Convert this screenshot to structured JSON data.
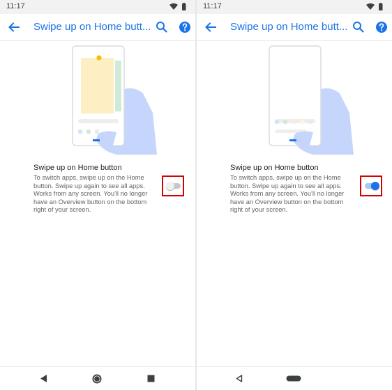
{
  "colors": {
    "accent": "#1a73e8",
    "highlight_border": "#d50000",
    "status_bar": "#f2f2f2",
    "hand": "#c5d5fb",
    "card_yellow": "#fdefc3",
    "card_green": "#cfead6",
    "dot_orange": "#fbbc04"
  },
  "icons": {
    "back": "arrow-back-icon",
    "search": "search-icon",
    "help": "help-icon",
    "wifi": "wifi-icon",
    "battery": "battery-icon",
    "nav_back": "nav-back-icon",
    "nav_home": "nav-home-icon",
    "nav_recents": "nav-recents-icon",
    "gesture_pill": "home-pill-icon"
  },
  "left_screen": {
    "status": {
      "time": "11:17"
    },
    "toolbar": {
      "title": "Swipe up on Home butt..."
    },
    "setting": {
      "title": "Swipe up on Home button",
      "description": "To switch apps, swipe up on the Home button. Swipe up again to see all apps. Works from any screen. You'll no longer have an Overview button on the bottom right of your screen.",
      "enabled": false
    },
    "navbar": {
      "style": "three-button"
    }
  },
  "right_screen": {
    "status": {
      "time": "11:17"
    },
    "toolbar": {
      "title": "Swipe up on Home butt..."
    },
    "setting": {
      "title": "Swipe up on Home button",
      "description": "To switch apps, swipe up on the Home button. Swipe up again to see all apps. Works from any screen. You'll no longer have an Overview button on the bottom right of your screen.",
      "enabled": true
    },
    "navbar": {
      "style": "gesture-pill"
    }
  }
}
